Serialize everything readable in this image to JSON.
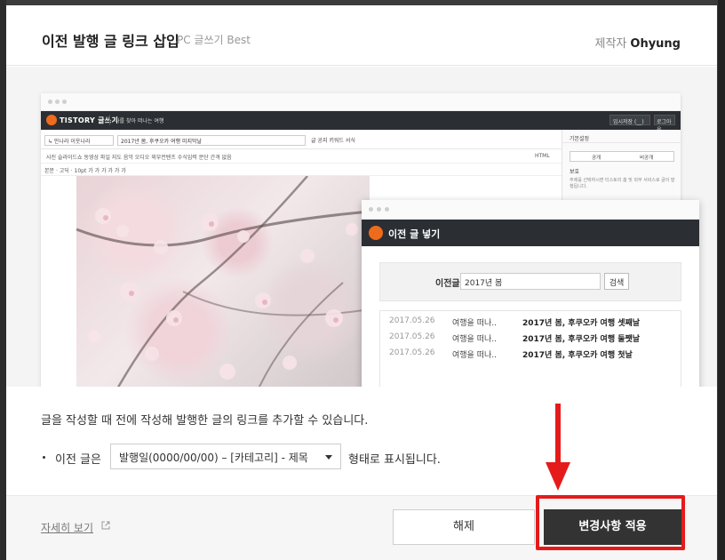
{
  "header": {
    "title": "이전 발행 글 링크 삽입",
    "subtitle": "PC 글쓰기 Best",
    "author_label": "제작자",
    "author_name": "Ohyung"
  },
  "preview": {
    "editor": {
      "brand": "TISTORY 글쓰기",
      "blog_select": "나를 찾아 떠나는 여행",
      "save_button": "임시저장 (__)",
      "logout_button": "로그아웃",
      "category_select": "↳ 안나라 이웃나라",
      "title_input": "2017년 봄, 후쿠오카 여행 미지막날",
      "radio_options": "글  공지  키워드  서식",
      "toolbar_insert": "사진  슬라이드쇼  동영상  파일  지도  음악  오디오  외부컨텐츠  수식입력    문단 간격 없음",
      "toolbar_html": "HTML",
      "toolbar_format": "본문   ·   고딕   ·   10pt   가  가  가  가  가  가",
      "sidebar_heading": "기본설정",
      "sidebar_public": "공개",
      "sidebar_private": "비공개",
      "sidebar_protect": "보호",
      "sidebar_note": "주제를 선택하시면 티스토리 홈 및 외부 서비스로 글이 발행됩니다."
    },
    "popup": {
      "title": "이전 글 넣기",
      "search_label": "이전글",
      "search_value": "2017년 봄",
      "search_button": "검색",
      "rows": [
        {
          "date": "2017.05.26",
          "category": "여행을 떠나..",
          "name": "2017년 봄, 후쿠오카 여행 셋째날"
        },
        {
          "date": "2017.05.26",
          "category": "여행을 떠나..",
          "name": "2017년 봄, 후쿠오카 여행 둘쨋날"
        },
        {
          "date": "2017.05.26",
          "category": "여행을 떠나..",
          "name": "2017년 봄, 후쿠오카 여행 첫날"
        }
      ]
    }
  },
  "body": {
    "description": "글을 작성할 때 전에 작성해 발행한 글의 링크를 추가할 수 있습니다.",
    "prev_label": "이전 글은",
    "format_select": "발행일(0000/00/00) – [카테고리] - 제목",
    "after_text": "형태로 표시됩니다."
  },
  "footer": {
    "details_link": "자세히 보기",
    "cancel_button": "해제",
    "apply_button": "변경사항 적용"
  },
  "colors": {
    "accent": "#ef6b1c",
    "highlight": "#e51b1b",
    "primary_button": "#333333"
  }
}
